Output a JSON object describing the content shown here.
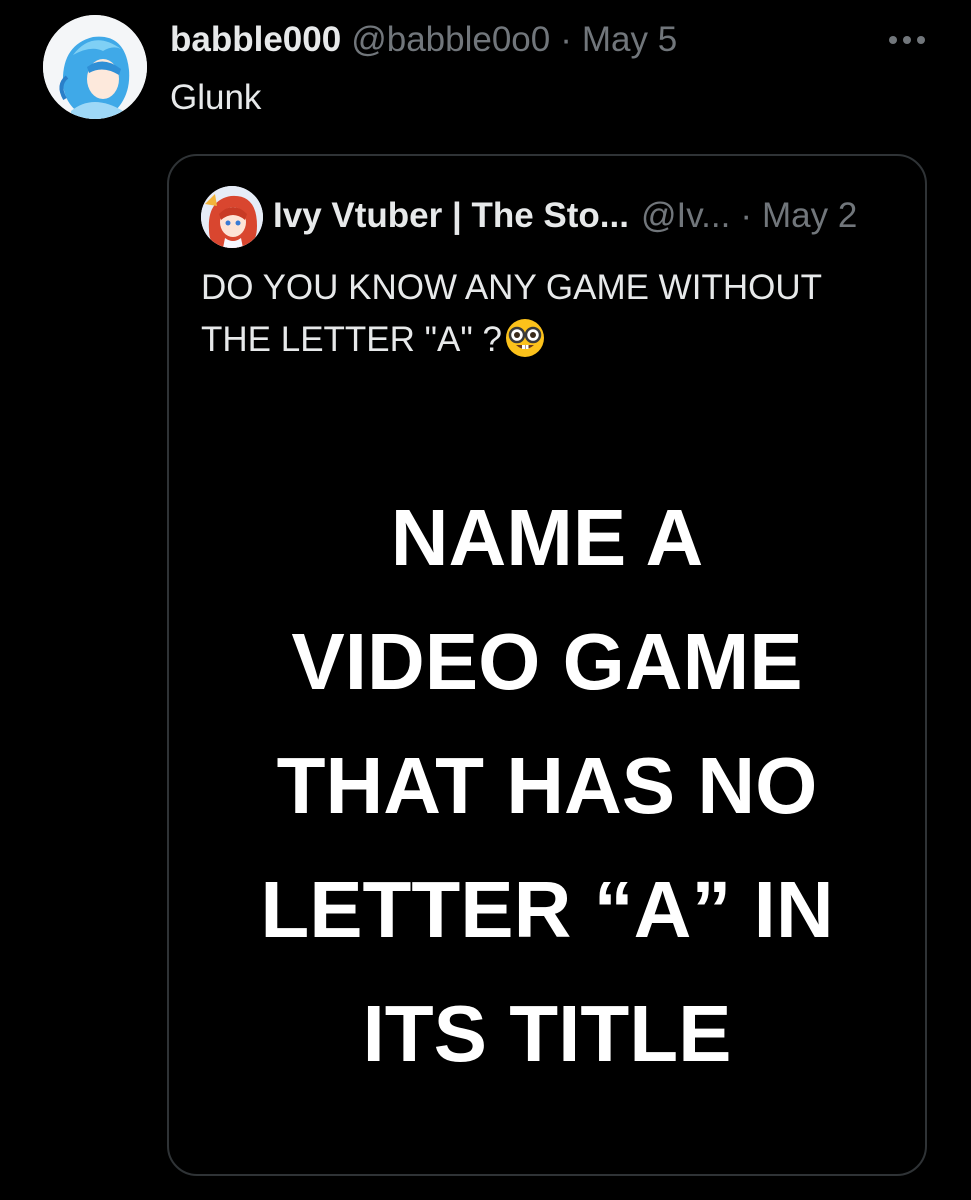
{
  "tweet": {
    "author": {
      "display_name": "babble000",
      "handle": "@babble0o0",
      "avatar_icon": "anime-avatar-blue-hair"
    },
    "separator": "·",
    "date": "May 5",
    "text": "Glunk",
    "more_icon": "ellipsis-icon"
  },
  "quote": {
    "author": {
      "display_name": "Ivy Vtuber | The Sto...",
      "handle": "@Iv...",
      "avatar_icon": "anime-avatar-red-hair"
    },
    "separator": "·",
    "date": "May 2",
    "text_line1": "DO YOU KNOW ANY GAME WITHOUT",
    "text_line2": "THE LETTER \"A\" ?",
    "emoji_icon": "nerd-face-emoji",
    "media": {
      "lines": [
        "NAME A",
        "VIDEO GAME",
        "THAT HAS NO",
        "LETTER “A” IN",
        "ITS TITLE"
      ]
    }
  },
  "colors": {
    "background": "#000000",
    "primary_text": "#e7e9ea",
    "secondary_text": "#71767b",
    "border": "#2f3336"
  }
}
